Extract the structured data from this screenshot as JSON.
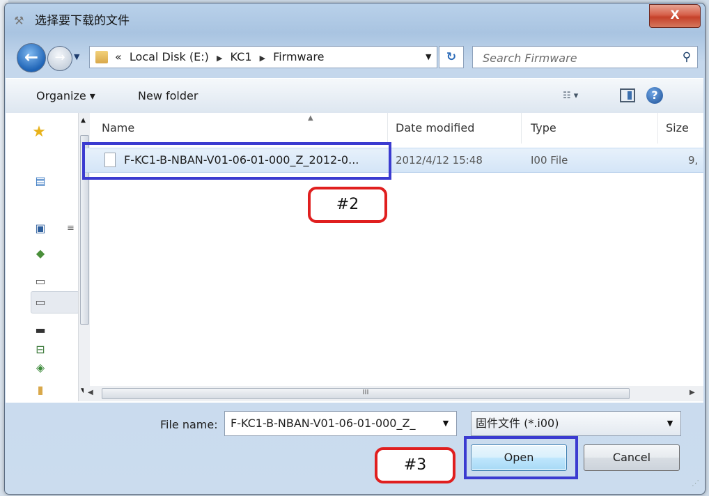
{
  "window": {
    "title": "选择要下载的文件",
    "close_label": "X"
  },
  "nav": {
    "path": [
      "«",
      "Local Disk (E:)",
      "KC1",
      "Firmware"
    ],
    "search_placeholder": "Search Firmware"
  },
  "toolbar": {
    "organize_label": "Organize ▾",
    "new_folder_label": "New folder",
    "views_label": "☷ ▾",
    "help_label": "?"
  },
  "columns": {
    "name": "Name",
    "date_modified": "Date modified",
    "type": "Type",
    "size": "Size"
  },
  "files": [
    {
      "name": "F-KC1-B-NBAN-V01-06-01-000_Z_2012-0...",
      "date_modified": "2012/4/12 15:48",
      "type": "I00 File",
      "size": "9,"
    }
  ],
  "hscroll_grip": "III",
  "footer": {
    "file_name_label": "File name:",
    "file_name_value": "F-KC1-B-NBAN-V01-06-01-000_Z_",
    "file_type_value": "固件文件 (*.i00)",
    "open_label": "Open",
    "cancel_label": "Cancel"
  },
  "annotations": {
    "tag2": "#2",
    "tag3": "#3",
    "colors": {
      "box": "#3b3bd0",
      "tag": "#e01f1f"
    }
  }
}
